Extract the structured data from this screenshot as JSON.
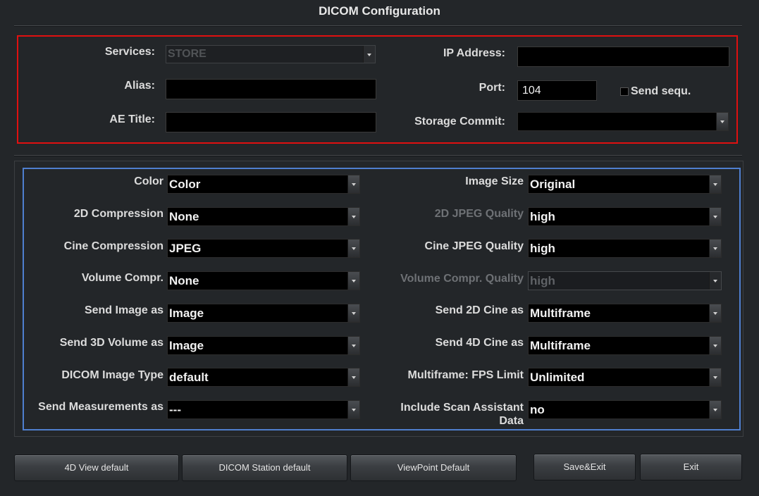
{
  "title": "DICOM Configuration",
  "network": {
    "services_label": "Services:",
    "services_value": "STORE",
    "alias_label": "Alias:",
    "alias_value": "",
    "ae_title_label": "AE Title:",
    "ae_title_value": "",
    "ip_label": "IP Address:",
    "ip_value": "",
    "port_label": "Port:",
    "port_value": "104",
    "send_sequ_label": "Send sequ.",
    "storage_commit_label": "Storage Commit:",
    "storage_commit_value": ""
  },
  "image": {
    "left": [
      {
        "label": "Color",
        "value": "Color"
      },
      {
        "label": "2D Compression",
        "value": "None"
      },
      {
        "label": "Cine Compression",
        "value": "JPEG"
      },
      {
        "label": "Volume Compr.",
        "value": "None"
      },
      {
        "label": "Send Image as",
        "value": "Image"
      },
      {
        "label": "Send 3D Volume as",
        "value": "Image"
      },
      {
        "label": "DICOM Image Type",
        "value": "default"
      },
      {
        "label": "Send Measurements as",
        "value": "---"
      }
    ],
    "right": [
      {
        "label": "Image Size",
        "value": "Original"
      },
      {
        "label": "2D JPEG Quality",
        "value": "high"
      },
      {
        "label": "Cine JPEG Quality",
        "value": "high"
      },
      {
        "label": "Volume Compr. Quality",
        "value": "high"
      },
      {
        "label": "Send 2D Cine as",
        "value": "Multiframe"
      },
      {
        "label": "Send 4D Cine as",
        "value": "Multiframe"
      },
      {
        "label": "Multiframe: FPS Limit",
        "value": "Unlimited"
      },
      {
        "label": "Include Scan Assistant Data",
        "value": "no"
      }
    ]
  },
  "buttons": {
    "view4d_default": "4D View default",
    "dicom_station_default": "DICOM Station default",
    "viewpoint_default": "ViewPoint Default",
    "save_exit": "Save&Exit",
    "exit": "Exit"
  }
}
